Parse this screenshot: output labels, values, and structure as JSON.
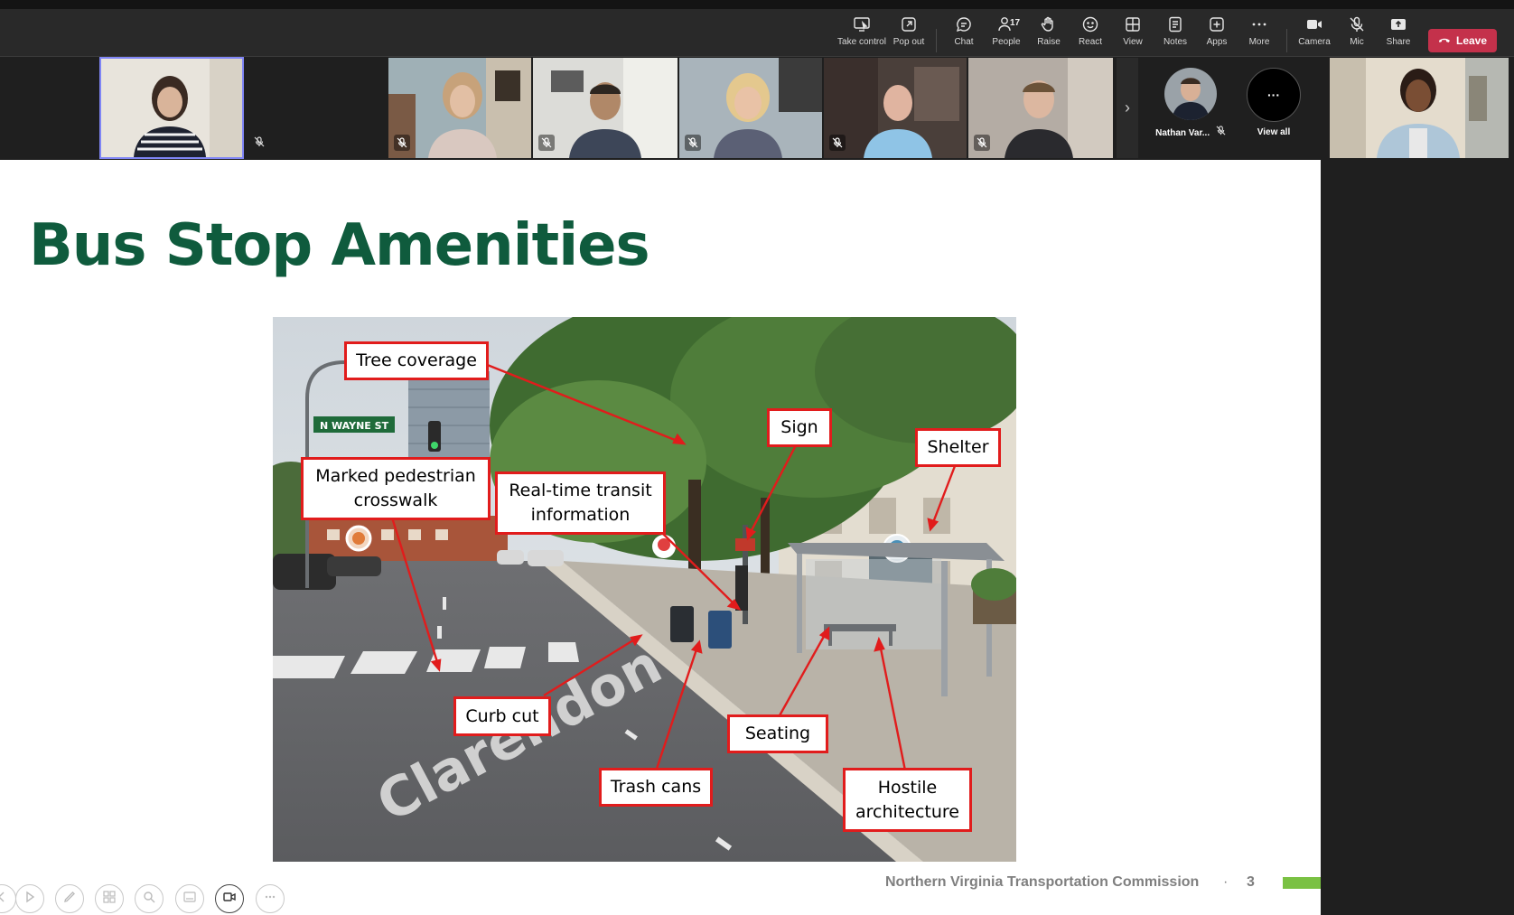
{
  "toolbar": {
    "items": [
      {
        "label": "Take control",
        "icon": "take-control-icon"
      },
      {
        "label": "Pop out",
        "icon": "pop-out-icon"
      },
      {
        "label": "Chat",
        "icon": "chat-icon"
      },
      {
        "label": "People",
        "icon": "people-icon",
        "count": "17"
      },
      {
        "label": "Raise",
        "icon": "raise-hand-icon"
      },
      {
        "label": "React",
        "icon": "react-icon"
      },
      {
        "label": "View",
        "icon": "view-icon"
      },
      {
        "label": "Notes",
        "icon": "notes-icon"
      },
      {
        "label": "Apps",
        "icon": "apps-icon"
      },
      {
        "label": "More",
        "icon": "more-icon"
      },
      {
        "label": "Camera",
        "icon": "camera-icon"
      },
      {
        "label": "Mic",
        "icon": "mic-off-icon"
      },
      {
        "label": "Share",
        "icon": "share-icon"
      }
    ],
    "leave_label": "Leave",
    "leave_color": "#c4314b"
  },
  "gallery": {
    "participants": [
      {
        "name": "Nathan Var...",
        "muted": true
      }
    ],
    "view_all_label": "View all",
    "more_glyph": "···"
  },
  "slide": {
    "title": "Bus Stop Amenities",
    "title_color": "#0f5b3d",
    "photo_street_sign": "N WAYNE ST",
    "callouts": {
      "tree": "Tree coverage",
      "sign": "Sign",
      "shelter": "Shelter",
      "crosswalk_l1": "Marked pedestrian",
      "crosswalk_l2": "crosswalk",
      "realtime_l1": "Real-time transit",
      "realtime_l2": "information",
      "curbcut": "Curb cut",
      "seating": "Seating",
      "trash": "Trash cans",
      "hostile_l1": "Hostile",
      "hostile_l2": "architecture"
    },
    "footer_org": "Northern Virginia Transportation Commission",
    "footer_sep": "·",
    "page_number": "3",
    "accent_color": "#7ac143"
  }
}
